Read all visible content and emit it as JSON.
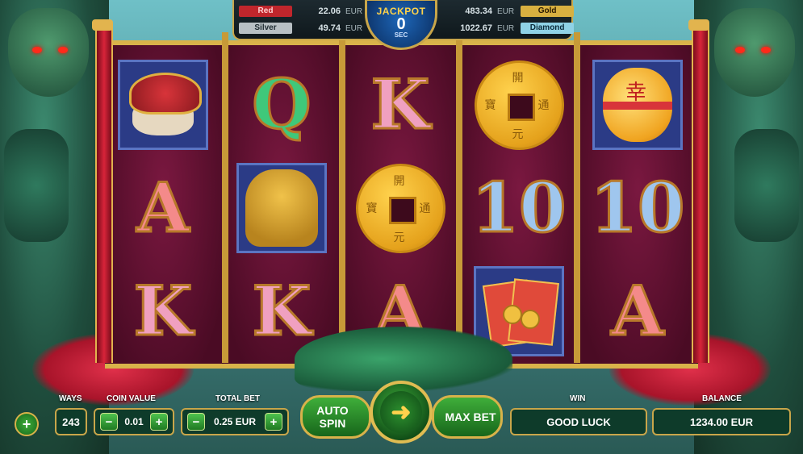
{
  "jackpot": {
    "title": "JACKPOT",
    "countdown": "0",
    "unit": "SEC",
    "tiers": [
      {
        "name": "Red",
        "value": "22.06",
        "currency": "EUR",
        "color": "#c0262c",
        "text": "#ffd0d0"
      },
      {
        "name": "Silver",
        "value": "49.74",
        "currency": "EUR",
        "color": "#b8c0c4",
        "text": "#1d2a30"
      },
      {
        "name": "Gold",
        "value": "483.34",
        "currency": "EUR",
        "color": "#d8b040",
        "text": "#2a1a00"
      },
      {
        "name": "Diamond",
        "value": "1022.67",
        "currency": "EUR",
        "color": "#8fd2e6",
        "text": "#0a2a3a"
      }
    ]
  },
  "reels": [
    [
      "turtle",
      "A",
      "K"
    ],
    [
      "Q",
      "lion",
      "K"
    ],
    [
      "K",
      "coin",
      "A"
    ],
    [
      "coin",
      "10",
      "envelopes"
    ],
    [
      "lantern",
      "10",
      "A"
    ]
  ],
  "symbol_icons": {
    "turtle": "turtle-icon",
    "lion": "lion-statue-icon",
    "coin": "gold-coin-icon",
    "lantern": "lantern-icon",
    "envelopes": "red-envelopes-icon"
  },
  "coin_chars": [
    "開",
    "通",
    "元",
    "寶"
  ],
  "lantern_char": "幸",
  "controls": {
    "add_icon": "+",
    "ways_label": "WAYS",
    "ways_value": "243",
    "coin_value_label": "COIN VALUE",
    "coin_value": "0.01",
    "total_bet_label": "TOTAL BET",
    "total_bet": "0.25 EUR",
    "minus": "−",
    "plus": "+",
    "auto_spin": "AUTO SPIN",
    "max_bet": "MAX BET",
    "spin_icon": "➜",
    "win_label": "WIN",
    "win_value": "GOOD LUCK",
    "balance_label": "BALANCE",
    "balance_value": "1234.00 EUR"
  }
}
